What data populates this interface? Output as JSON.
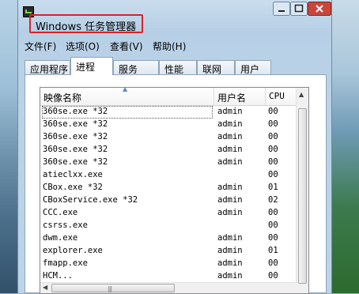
{
  "window": {
    "title": "Windows 任务管理器"
  },
  "menu": [
    {
      "label": "文件(F)"
    },
    {
      "label": "选项(O)"
    },
    {
      "label": "查看(V)"
    },
    {
      "label": "帮助(H)"
    }
  ],
  "tabs": [
    {
      "label": "应用程序",
      "active": false
    },
    {
      "label": "进程",
      "active": true
    },
    {
      "label": "服务",
      "active": false
    },
    {
      "label": "性能",
      "active": false
    },
    {
      "label": "联网",
      "active": false
    },
    {
      "label": "用户",
      "active": false
    }
  ],
  "table": {
    "columns": [
      "映像名称",
      "用户名",
      "CPU"
    ],
    "sort_indicator": "▲",
    "rows": [
      {
        "name": "360se.exe *32",
        "user": "admin",
        "cpu": "00",
        "selected": true
      },
      {
        "name": "360se.exe *32",
        "user": "admin",
        "cpu": "00"
      },
      {
        "name": "360se.exe *32",
        "user": "admin",
        "cpu": "00"
      },
      {
        "name": "360se.exe *32",
        "user": "admin",
        "cpu": "00"
      },
      {
        "name": "360se.exe *32",
        "user": "admin",
        "cpu": "00"
      },
      {
        "name": "atieclxx.exe",
        "user": "",
        "cpu": "00"
      },
      {
        "name": "CBox.exe *32",
        "user": "admin",
        "cpu": "01"
      },
      {
        "name": "CBoxService.exe *32",
        "user": "admin",
        "cpu": "02"
      },
      {
        "name": "CCC.exe",
        "user": "admin",
        "cpu": "00"
      },
      {
        "name": "csrss.exe",
        "user": "",
        "cpu": "00"
      },
      {
        "name": "dwm.exe",
        "user": "admin",
        "cpu": "00"
      },
      {
        "name": "explorer.exe",
        "user": "admin",
        "cpu": "01"
      },
      {
        "name": "fmapp.exe",
        "user": "admin",
        "cpu": "00"
      },
      {
        "name": "HCM...",
        "user": "admin",
        "cpu": "00"
      }
    ]
  },
  "colors": {
    "title_highlight": "#d8232a",
    "close_button": "#c9463d"
  }
}
